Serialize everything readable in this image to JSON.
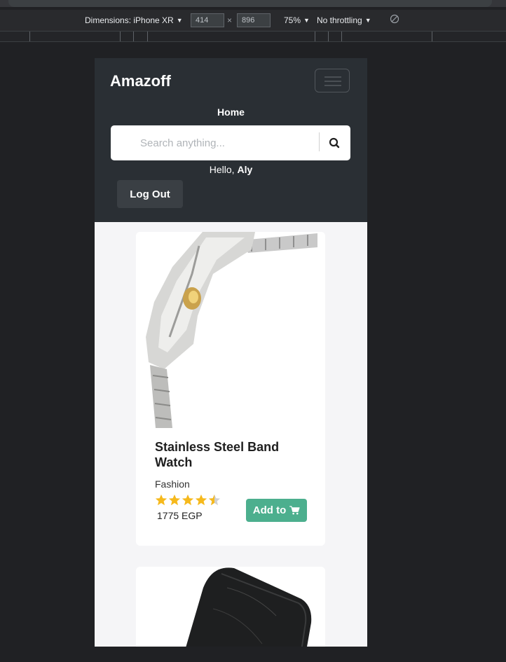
{
  "devtools": {
    "dimensions_label": "Dimensions: iPhone XR",
    "width": "414",
    "height": "896",
    "zoom": "75%",
    "throttling": "No throttling"
  },
  "navbar": {
    "brand": "Amazoff",
    "home_link": "Home",
    "search_placeholder": "Search anything...",
    "greeting": "Hello,",
    "username": "Aly",
    "logout_label": "Log Out"
  },
  "products": [
    {
      "title": "Stainless Steel Band Watch",
      "category": "Fashion",
      "rating": 4.5,
      "price": "1775 EGP",
      "add_label": "Add to"
    }
  ],
  "colors": {
    "navbar_bg": "#2a2f34",
    "accent_button": "#4caf8e",
    "star": "#f6b91c"
  },
  "icons": {
    "search": "search-icon",
    "cart": "cart-icon",
    "menu": "hamburger-icon"
  }
}
